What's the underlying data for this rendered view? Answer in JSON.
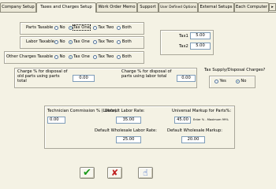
{
  "tabs": [
    {
      "label": "Company Setup",
      "active": false
    },
    {
      "label": "Taxes and Charges Setup",
      "active": true
    },
    {
      "label": "Work Order Memo",
      "active": false
    },
    {
      "label": "Support",
      "active": false
    },
    {
      "label": "User Defined Options",
      "active": false
    },
    {
      "label": "External Setups",
      "active": false
    },
    {
      "label": "Each Computer",
      "active": false
    }
  ],
  "tab_scroll_arrow": "▸",
  "taxable": {
    "parts": {
      "label": "Parts Taxable",
      "options": [
        "No",
        "Tax One",
        "Tax Two",
        "Both"
      ],
      "selected": "Tax One"
    },
    "labor": {
      "label": "Labor Taxable",
      "options": [
        "No",
        "Tax One",
        "Tax Two",
        "Both"
      ],
      "selected": "Tax One"
    },
    "other": {
      "label": "Other Charges Taxable",
      "options": [
        "No",
        "Tax One",
        "Tax Two",
        "Both"
      ],
      "selected": "Tax One"
    }
  },
  "tax_rates": {
    "tax1_label": "Tax1",
    "tax1_value": "5.00",
    "tax2_label": "Tax2",
    "tax2_value": "5.00"
  },
  "disposal": {
    "parts_label": "Charge % for disposal of old parts using parts total",
    "parts_value": "0.00",
    "labor_label": "Charge % for disposal of parts using labor total",
    "labor_value": "0.00"
  },
  "supply_disposal": {
    "question": "Tax Supply/Disposal Charges?",
    "options": [
      "Yes",
      "No"
    ],
    "selected": "No"
  },
  "commission": {
    "tech_label": "Technician Commission % (Labor):",
    "tech_value": "0.00",
    "labor_rate_label": "Default Labor Rate:",
    "labor_rate_value": "35.00",
    "markup_label": "Universal Markup for Parts%:",
    "markup_value": "45.00",
    "markup_note": "Enter % - Maximum 99%",
    "wholesale_labor_label": "Default Wholesale Labor Rate:",
    "wholesale_labor_value": "25.00",
    "wholesale_markup_label": "Default Wholesale Markup:",
    "wholesale_markup_value": "20.00"
  },
  "buttons": {
    "ok_icon": "✔",
    "cancel_icon": "✘",
    "help_icon": "☝"
  },
  "colors": {
    "ok": "#1a9a1a",
    "cancel": "#c02020",
    "help": "#1d4fbf"
  }
}
